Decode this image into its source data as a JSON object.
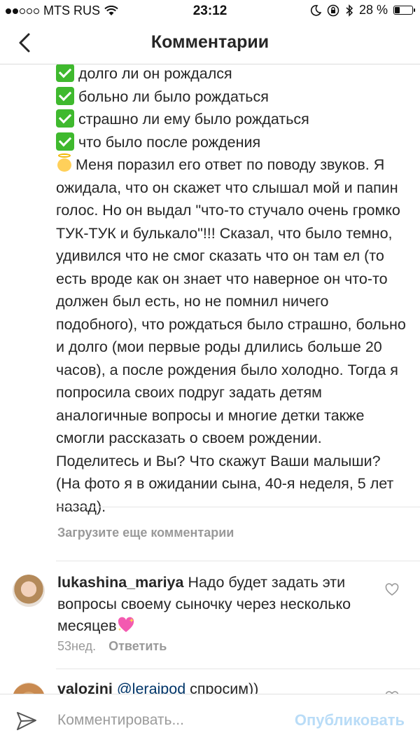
{
  "status_bar": {
    "carrier": "MTS RUS",
    "time": "23:12",
    "battery": "28 %",
    "battery_level": 0.28
  },
  "header": {
    "title": "Комментарии",
    "back_icon": "chevron-left-icon"
  },
  "caption": {
    "checklist": [
      "долго ли он рождался",
      "больно ли было рождаться",
      "страшно ли ему было рождаться",
      "что было после рождения"
    ],
    "body": "Меня поразил его ответ по поводу звуков. Я ожидала, что он скажет что слышал мой и папин голос. Но он выдал \"что-то стучало очень громко ТУК-ТУК и булькало\"!!! Сказал, что было темно, удивился что не смог сказать что он там ел (то есть вроде как он знает что наверное он что-то должен был есть, но не помнил ничего подобного), что рождаться было страшно, больно и долго (мои первые роды длились больше 20 часов), а после рождения было холодно. Тогда я попросила своих подруг задать детям аналогичные вопросы и многие детки также смогли рассказать о своем рождении. Поделитесь и Вы? Что скажут Ваши малыши? (На фото я в ожидании сына, 40-я неделя, 5 лет назад)."
  },
  "load_more": "Загрузите еще комментарии",
  "comments": [
    {
      "username": "lukashina_mariya",
      "text": "Надо будет задать эти вопросы своему сыночку через несколько месяцев",
      "time": "53нед.",
      "reply": "Ответить"
    },
    {
      "username": "valozini",
      "mention": "@leraipod",
      "text": "спросим))"
    }
  ],
  "input_bar": {
    "placeholder": "Комментировать...",
    "publish": "Опубликовать"
  },
  "colors": {
    "check_green": "#3fb92e",
    "publish_disabled": "#b9dcf7",
    "mention": "#003569",
    "muted": "#999999"
  }
}
